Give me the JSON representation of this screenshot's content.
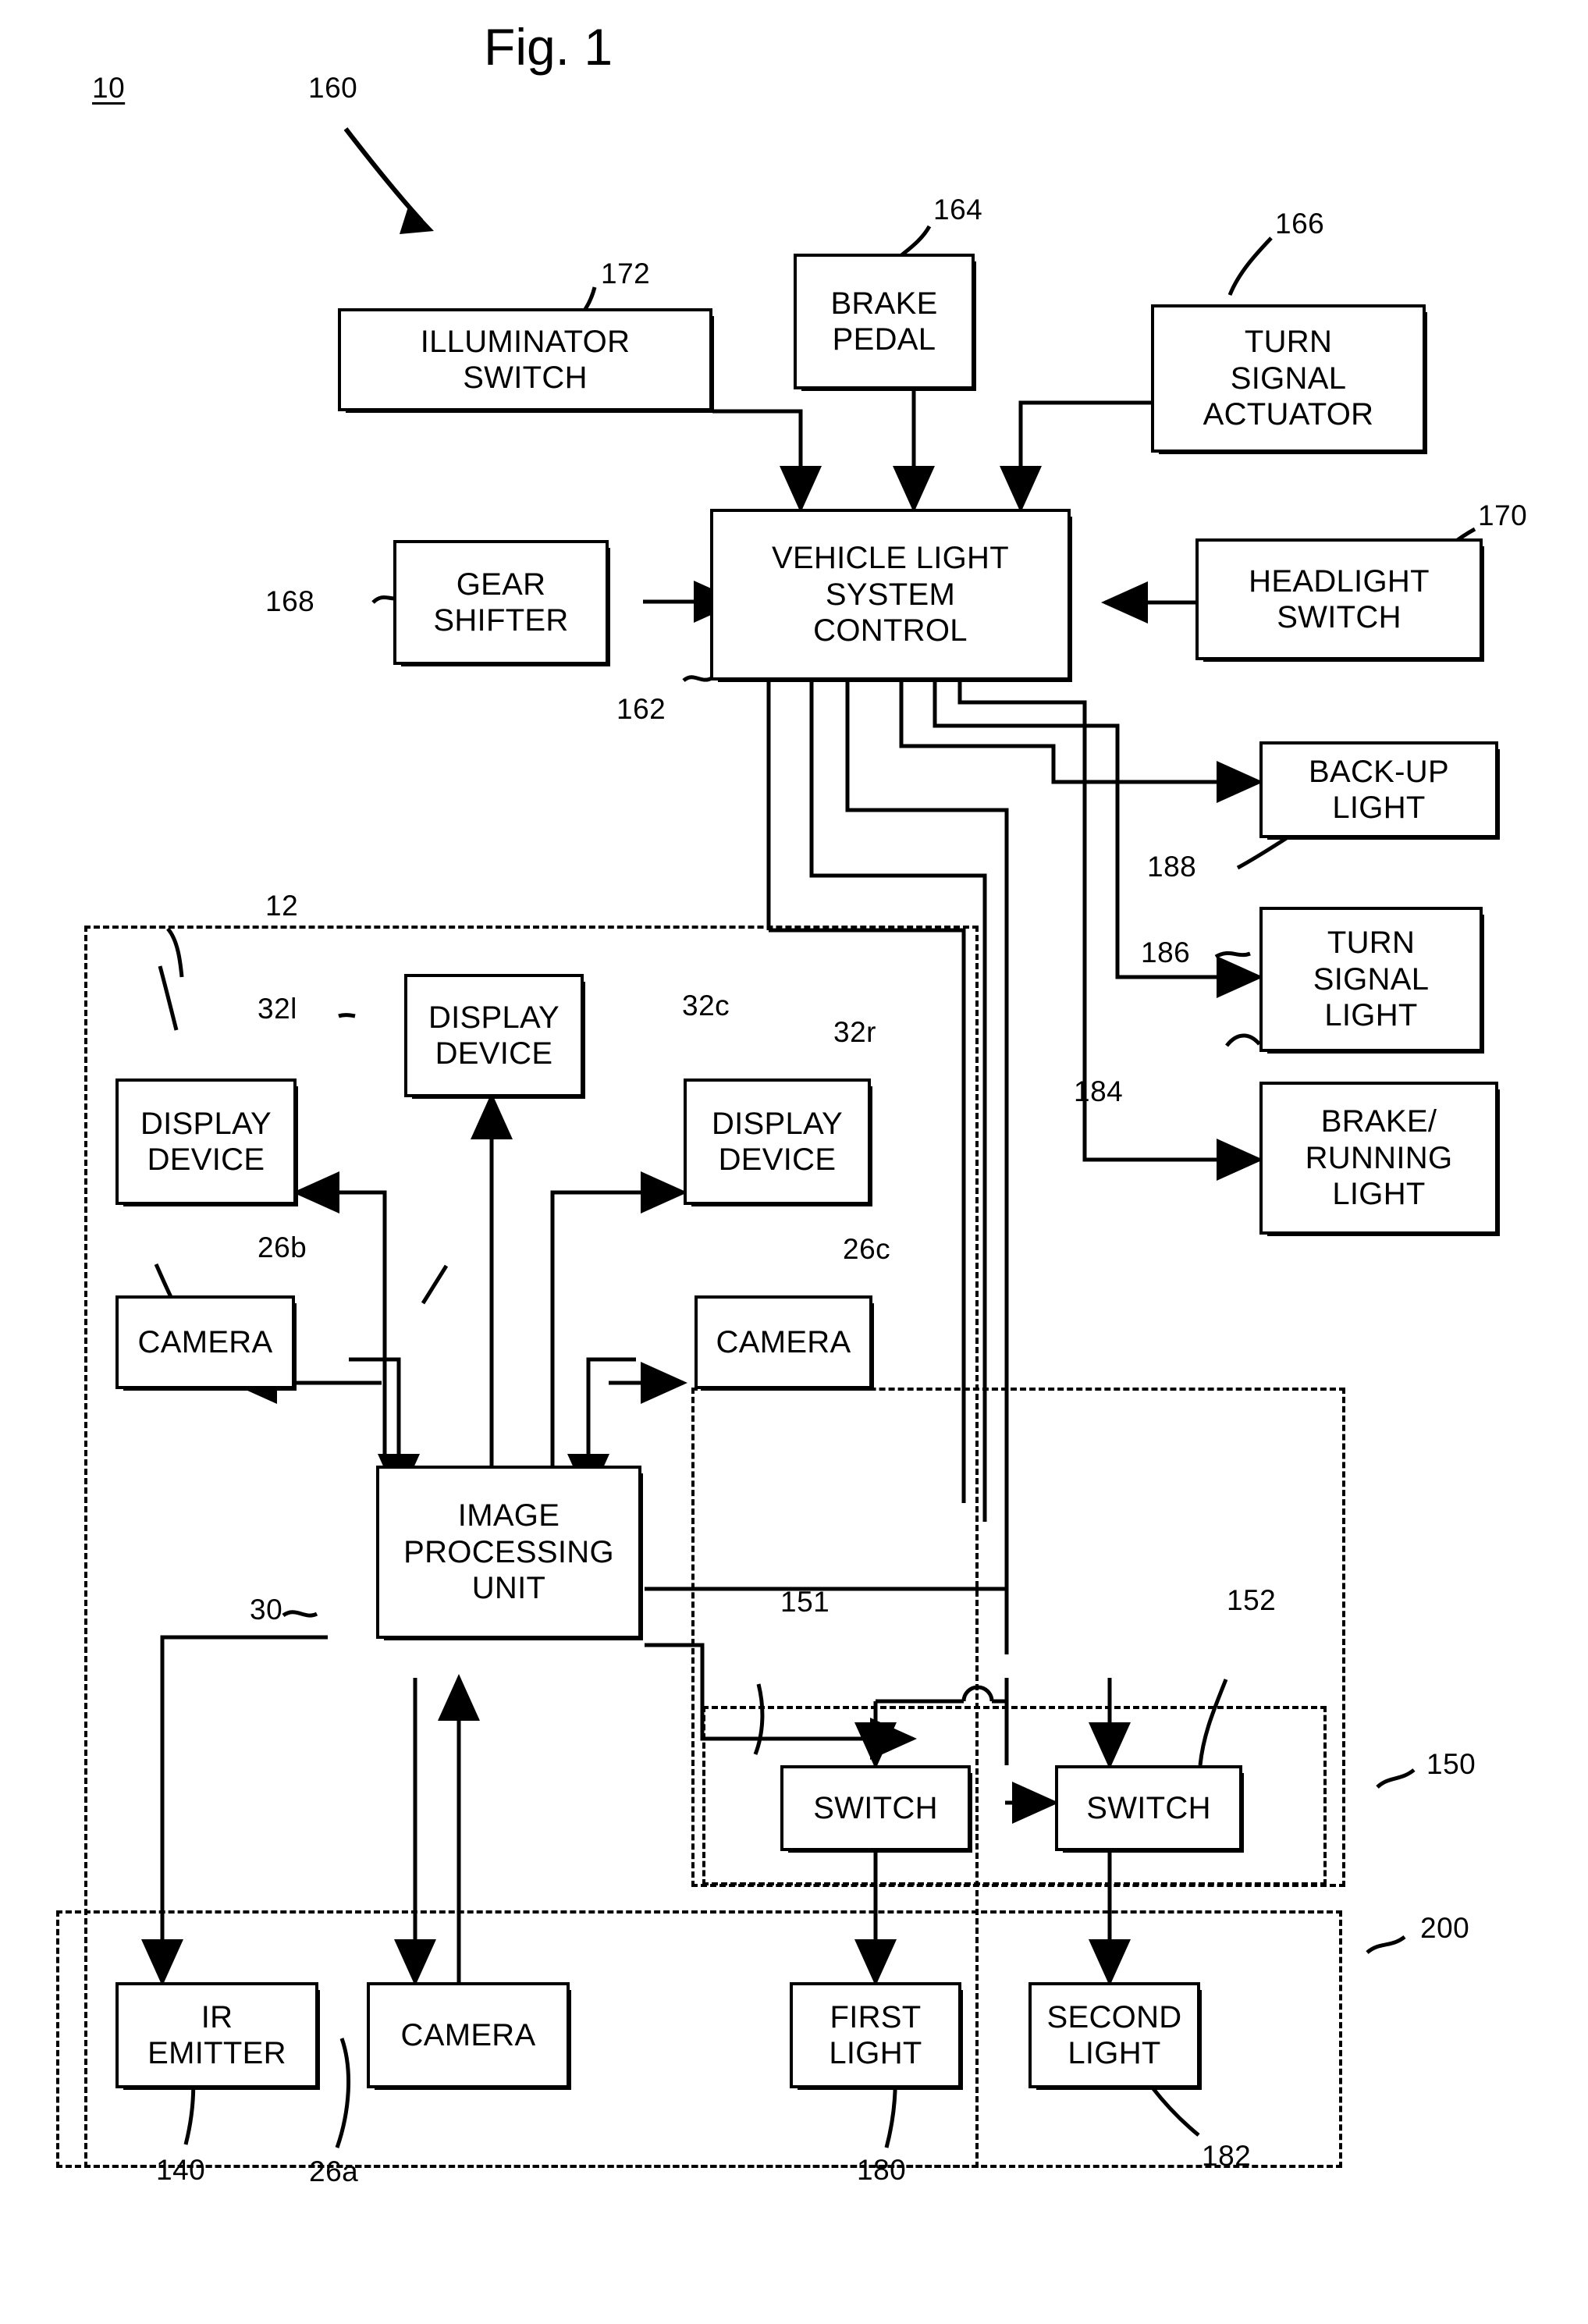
{
  "figure": {
    "title": "Fig. 1",
    "system_ref": "10"
  },
  "refs": {
    "system": "10",
    "light_system": "160",
    "control": "162",
    "brake_pedal": "164",
    "turn_signal_actuator": "166",
    "gear_shifter": "168",
    "headlight_switch": "170",
    "illuminator_switch": "172",
    "vision_system": "12",
    "display_left": "32l",
    "display_center": "32c",
    "display_right": "32r",
    "camera_b": "26b",
    "camera_c": "26c",
    "camera_a": "26a",
    "image_processing_unit": "30",
    "switch_first": "151",
    "switch_second": "152",
    "switch_group": "150",
    "light_group": "200",
    "ir_emitter": "140",
    "first_light": "180",
    "second_light": "182",
    "brake_running_light": "184",
    "turn_signal_light": "186",
    "backup_light": "188"
  },
  "blocks": {
    "illuminator_switch": "ILLUMINATOR\nSWITCH",
    "brake_pedal": "BRAKE\nPEDAL",
    "turn_signal_actuator": "TURN\nSIGNAL\nACTUATOR",
    "gear_shifter": "GEAR\nSHIFTER",
    "vehicle_light_system_control": "VEHICLE LIGHT\nSYSTEM\nCONTROL",
    "headlight_switch": "HEADLIGHT\nSWITCH",
    "backup_light": "BACK-UP\nLIGHT",
    "turn_signal_light": "TURN\nSIGNAL\nLIGHT",
    "brake_running_light": "BRAKE/\nRUNNING\nLIGHT",
    "display_device_center": "DISPLAY\nDEVICE",
    "display_device_left": "DISPLAY\nDEVICE",
    "display_device_right": "DISPLAY\nDEVICE",
    "camera_b": "CAMERA",
    "camera_c": "CAMERA",
    "image_processing_unit": "IMAGE\nPROCESSING\nUNIT",
    "switch_1": "SWITCH",
    "switch_2": "SWITCH",
    "ir_emitter": "IR\nEMITTER",
    "camera_a": "CAMERA",
    "first_light": "FIRST\nLIGHT",
    "second_light": "SECOND\nLIGHT"
  },
  "colors": {
    "ink": "#000000",
    "paper": "#ffffff"
  }
}
